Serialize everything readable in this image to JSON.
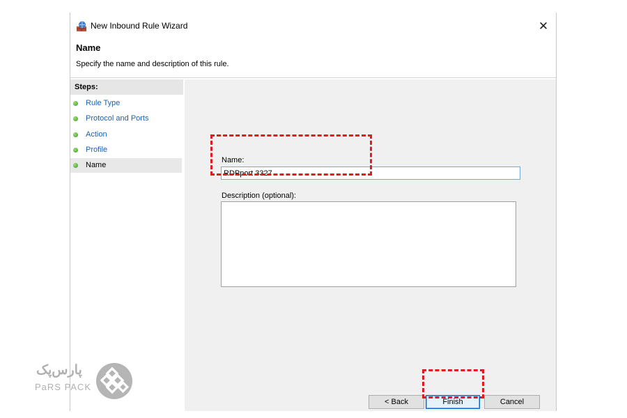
{
  "window": {
    "title": "New Inbound Rule Wizard",
    "close_icon": "close-icon",
    "app_icon": "firewall-icon"
  },
  "header": {
    "title": "Name",
    "subtitle": "Specify the name and description of this rule."
  },
  "steps": {
    "heading": "Steps:",
    "items": [
      {
        "label": "Rule Type",
        "state": "done"
      },
      {
        "label": "Protocol and Ports",
        "state": "done"
      },
      {
        "label": "Action",
        "state": "done"
      },
      {
        "label": "Profile",
        "state": "done"
      },
      {
        "label": "Name",
        "state": "current"
      }
    ]
  },
  "form": {
    "name_label": "Name:",
    "name_value": "RDPport 3327",
    "description_label": "Description (optional):",
    "description_value": ""
  },
  "buttons": {
    "back": "< Back",
    "finish": "Finish",
    "cancel": "Cancel"
  },
  "branding": {
    "logo_fa": "پارس‌پک",
    "logo_en": "PaRS PACK"
  },
  "colors": {
    "highlight": "#e01b22",
    "link": "#1a62b8",
    "step_done": "#3a9a1e"
  }
}
